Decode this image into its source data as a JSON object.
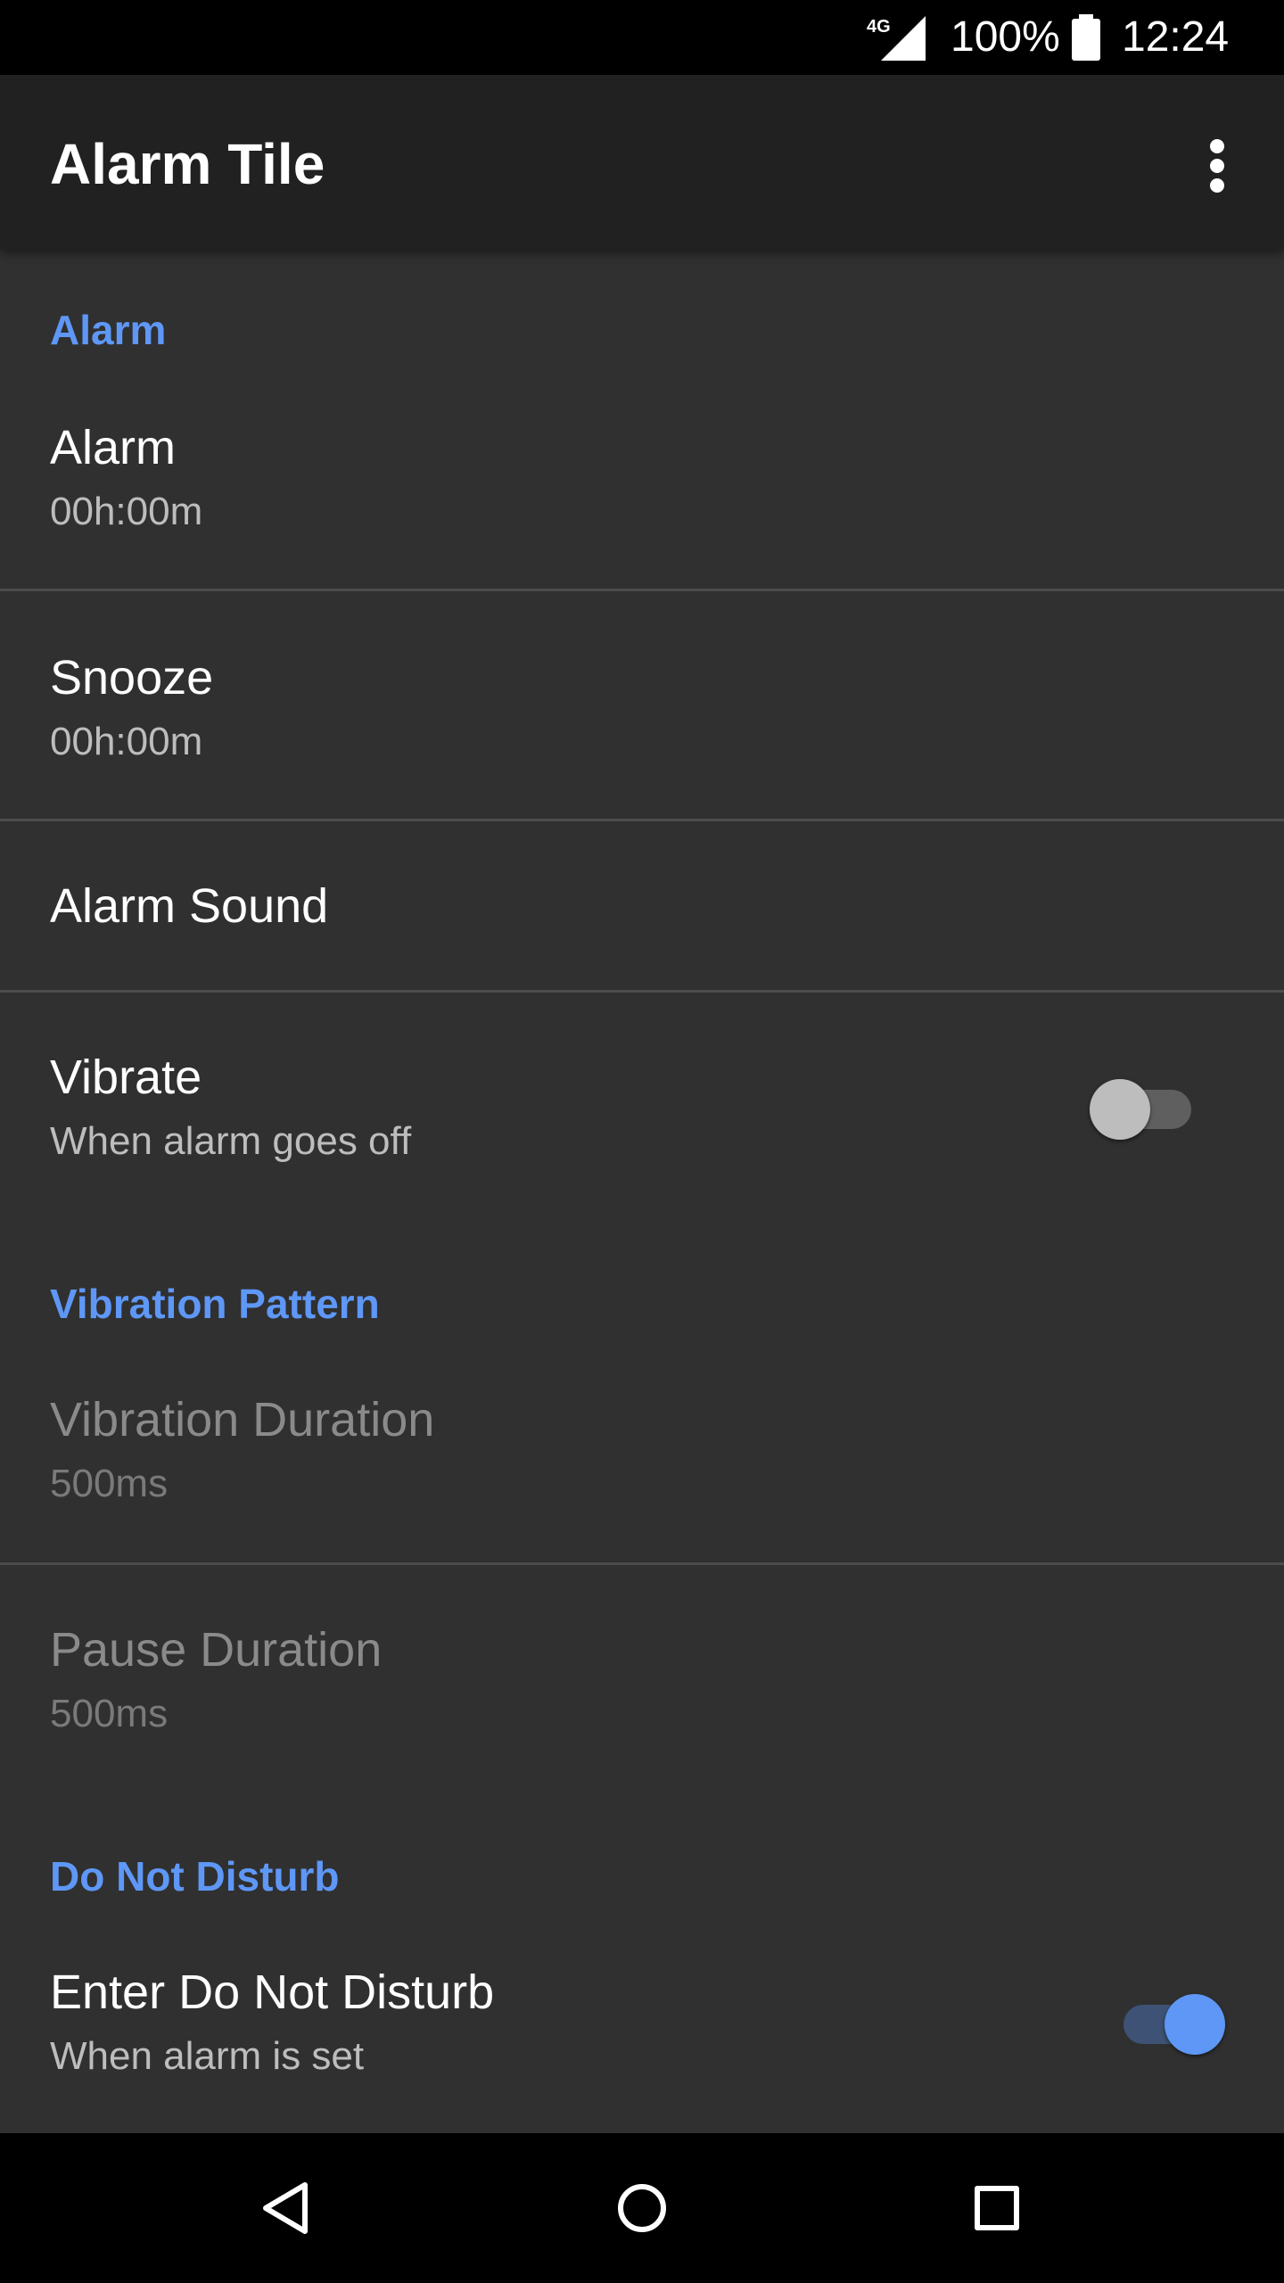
{
  "status_bar": {
    "network": "4G",
    "battery_percent": "100%",
    "time": "12:24",
    "icons": [
      "signal-4g-icon",
      "battery-full-icon"
    ]
  },
  "app_bar": {
    "title": "Alarm Tile",
    "overflow_icon": "more-vert-icon"
  },
  "sections": {
    "alarm": {
      "header": "Alarm",
      "items": [
        {
          "title": "Alarm",
          "summary": "00h:00m"
        },
        {
          "title": "Snooze",
          "summary": "00h:00m"
        },
        {
          "title": "Alarm Sound"
        },
        {
          "title": "Vibrate",
          "summary": "When alarm goes off",
          "switch_on": false
        }
      ]
    },
    "vibration_pattern": {
      "header": "Vibration Pattern",
      "items": [
        {
          "title": "Vibration Duration",
          "summary": "500ms",
          "enabled": false
        },
        {
          "title": "Pause Duration",
          "summary": "500ms",
          "enabled": false
        }
      ]
    },
    "do_not_disturb": {
      "header": "Do Not Disturb",
      "items": [
        {
          "title": "Enter Do Not Disturb",
          "summary": "When alarm is set",
          "switch_on": true
        }
      ]
    }
  },
  "nav_bar": {
    "icons": [
      "back-icon",
      "home-icon",
      "recents-icon"
    ]
  },
  "colors": {
    "accent": "#5e97f6",
    "background": "#303030",
    "app_bar": "#212121",
    "status_bar": "#000000"
  }
}
